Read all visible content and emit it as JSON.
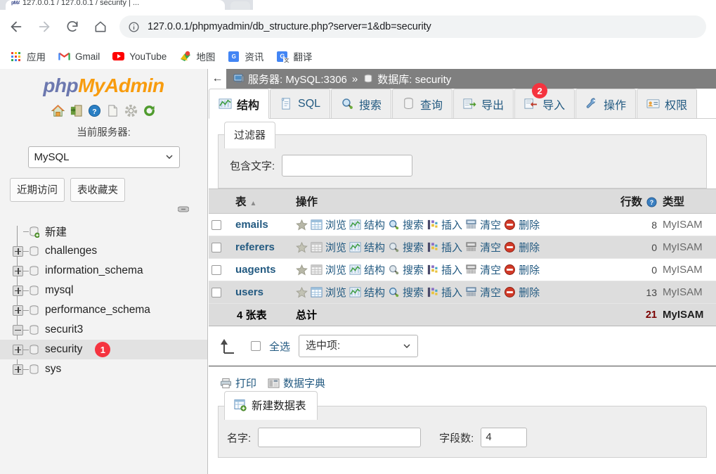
{
  "browser": {
    "tab_title": "127.0.0.1 / 127.0.0.1 / security | ...",
    "tab_favicon_text": "pMA",
    "url": "127.0.0.1/phpmyadmin/db_structure.php?server=1&db=security",
    "nav": {
      "back_icon": "arrow-left-icon",
      "forward_icon": "arrow-right-icon",
      "reload_icon": "reload-icon",
      "home_icon": "home-icon",
      "site_info_icon": "info-circle-icon"
    },
    "bookmarks": [
      {
        "label": "应用",
        "icon": "apps-grid-icon"
      },
      {
        "label": "Gmail",
        "icon": "gmail-icon"
      },
      {
        "label": "YouTube",
        "icon": "youtube-icon"
      },
      {
        "label": "地图",
        "icon": "google-maps-icon"
      },
      {
        "label": "资讯",
        "icon": "google-news-icon"
      },
      {
        "label": "翻译",
        "icon": "google-translate-icon"
      }
    ]
  },
  "sidebar": {
    "logo": {
      "part1": "php",
      "part2": "My",
      "part3": "Admin"
    },
    "header_icons": [
      "home-icon",
      "logout-icon",
      "help-icon",
      "docs-icon",
      "settings-icon",
      "refresh-icon"
    ],
    "current_server_label": "当前服务器:",
    "server_select_value": "MySQL",
    "quick_buttons": [
      {
        "label": "近期访问"
      },
      {
        "label": "表收藏夹"
      }
    ],
    "link_icon": "chain-link-icon",
    "tree": [
      {
        "label": "新建",
        "toggle": "none",
        "icon": "db-new-icon",
        "selected": false,
        "badge": null
      },
      {
        "label": "challenges",
        "toggle": "plus",
        "icon": "db-icon",
        "selected": false,
        "badge": null
      },
      {
        "label": "information_schema",
        "toggle": "plus",
        "icon": "db-icon",
        "selected": false,
        "badge": null
      },
      {
        "label": "mysql",
        "toggle": "plus",
        "icon": "db-icon",
        "selected": false,
        "badge": null
      },
      {
        "label": "performance_schema",
        "toggle": "plus",
        "icon": "db-icon",
        "selected": false,
        "badge": null
      },
      {
        "label": "securit3",
        "toggle": "minus",
        "icon": "db-icon",
        "selected": false,
        "badge": null
      },
      {
        "label": "security",
        "toggle": "plus",
        "icon": "db-icon",
        "selected": true,
        "badge": "1"
      },
      {
        "label": "sys",
        "toggle": "plus",
        "icon": "db-icon",
        "selected": false,
        "badge": null
      }
    ]
  },
  "main": {
    "breadcrumb": {
      "back_icon": "arrow-left-icon",
      "server_icon": "server-icon",
      "server_text": "服务器: MySQL:3306",
      "separator": "»",
      "db_icon": "database-icon",
      "db_text": "数据库: security"
    },
    "tabs": [
      {
        "label": "结构",
        "icon": "structure-icon",
        "active": true,
        "badge": null
      },
      {
        "label": "SQL",
        "icon": "sql-icon",
        "active": false,
        "badge": null
      },
      {
        "label": "搜索",
        "icon": "search-icon",
        "active": false,
        "badge": null
      },
      {
        "label": "查询",
        "icon": "query-icon",
        "active": false,
        "badge": null
      },
      {
        "label": "导出",
        "icon": "export-icon",
        "active": false,
        "badge": null
      },
      {
        "label": "导入",
        "icon": "import-icon",
        "active": false,
        "badge": "2"
      },
      {
        "label": "操作",
        "icon": "operations-icon",
        "active": false,
        "badge": null
      },
      {
        "label": "权限",
        "icon": "privileges-icon",
        "active": false,
        "badge": null
      }
    ],
    "filter": {
      "legend": "过滤器",
      "contains_label": "包含文字:",
      "contains_value": "",
      "contains_placeholder": ""
    },
    "table": {
      "headers": {
        "table": "表",
        "operations": "操作",
        "rows": "行数",
        "type": "类型",
        "rows_help_icon": "help-circle-icon",
        "sort_arrow": "▲"
      },
      "ops_labels": {
        "browse": "浏览",
        "structure": "结构",
        "search": "搜索",
        "insert": "插入",
        "empty": "清空",
        "drop": "删除"
      },
      "rows": [
        {
          "name": "emails",
          "rows": "8",
          "type": "MyISAM"
        },
        {
          "name": "referers",
          "rows": "0",
          "type": "MyISAM"
        },
        {
          "name": "uagents",
          "rows": "0",
          "type": "MyISAM"
        },
        {
          "name": "users",
          "rows": "13",
          "type": "MyISAM"
        }
      ],
      "summary": {
        "count_label": "4 张表",
        "total_label": "总计",
        "rows": "21",
        "type": "MyISAM"
      }
    },
    "footer": {
      "check_all_label": "全选",
      "with_selected_value": "选中项:",
      "print_label": "打印",
      "print_icon": "printer-icon",
      "data_dict_label": "数据字典",
      "data_dict_icon": "data-dictionary-icon"
    },
    "new_table": {
      "legend": "新建数据表",
      "legend_icon": "new-table-icon",
      "name_label": "名字:",
      "name_value": "",
      "cols_label": "字段数:",
      "cols_value": "4"
    }
  },
  "colors": {
    "badge_red": "#f5333f",
    "link_blue": "#235a81",
    "logo_blue": "#6c78af",
    "logo_orange": "#f89c0e",
    "breadcrumb_gray": "#7f7f7f",
    "sidebar_bg": "#f3f3f3"
  }
}
